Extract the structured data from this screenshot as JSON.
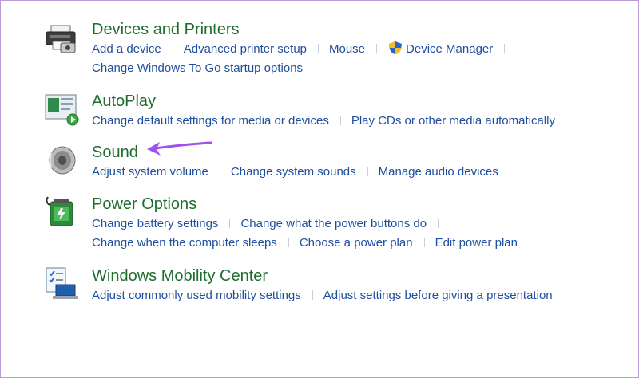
{
  "sections": [
    {
      "title": "Devices and Printers",
      "icon": "printer-icon",
      "rows": [
        [
          "Add a device",
          "Advanced printer setup",
          "Mouse",
          "Device Manager",
          ""
        ],
        [
          "Change Windows To Go startup options"
        ]
      ]
    },
    {
      "title": "AutoPlay",
      "icon": "autoplay-icon",
      "rows": [
        [
          "Change default settings for media or devices",
          "Play CDs or other media automatically"
        ]
      ]
    },
    {
      "title": "Sound",
      "icon": "speaker-icon",
      "rows": [
        [
          "Adjust system volume",
          "Change system sounds",
          "Manage audio devices"
        ]
      ]
    },
    {
      "title": "Power Options",
      "icon": "battery-icon",
      "rows": [
        [
          "Change battery settings",
          "Change what the power buttons do",
          ""
        ],
        [
          "Change when the computer sleeps",
          "Choose a power plan",
          "Edit power plan"
        ]
      ]
    },
    {
      "title": "Windows Mobility Center",
      "icon": "mobility-center-icon",
      "rows": [
        [
          "Adjust commonly used mobility settings",
          "Adjust settings before giving a presentation"
        ]
      ]
    }
  ],
  "annotation": {
    "icon": "purple-arrow-icon",
    "color": "#a24ff0"
  },
  "colors": {
    "title": "#1e6e2d",
    "link": "#1f4e9e"
  }
}
